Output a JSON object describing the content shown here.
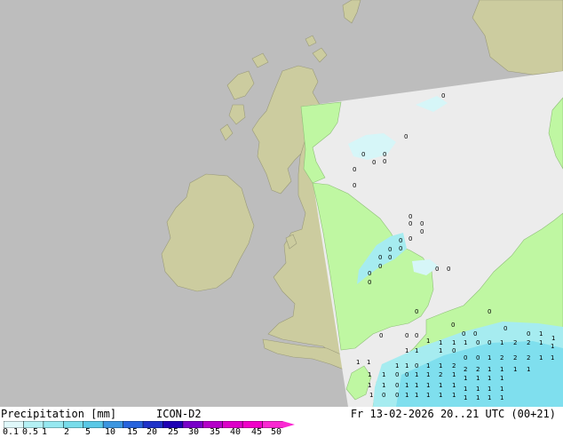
{
  "header": {
    "title": "Precipitation [mm]",
    "model": "ICON-D2",
    "datetime": "Fr 13-02-2026 20..21 UTC (00+21)"
  },
  "legend": {
    "ticks": [
      "0.1",
      "0.5",
      "1",
      "2",
      "5",
      "10",
      "15",
      "20",
      "25",
      "30",
      "35",
      "40",
      "45",
      "50"
    ],
    "colors": [
      "#e0f8fa",
      "#b4f0f4",
      "#96e8f0",
      "#78dcea",
      "#5ac8e6",
      "#3c96e0",
      "#2864dc",
      "#1e32c8",
      "#1e00b4",
      "#7800c8",
      "#b400c8",
      "#dc00c8",
      "#f000c8",
      "#fa28d2"
    ]
  },
  "map": {
    "colors": {
      "sea": "#bdbdbd",
      "land_outside": "#cccc9f",
      "domain_sea": "#ececec",
      "domain_land": "#bff7a2",
      "rain_light": "#a6ecf0",
      "rain_heavy": "#7fdfee"
    },
    "labels": [
      {
        "t": "0"
      },
      {
        "t": "0"
      },
      {
        "t": "0"
      },
      {
        "t": "0"
      },
      {
        "t": "0"
      },
      {
        "t": "0"
      },
      {
        "t": "0"
      },
      {
        "t": "0"
      },
      {
        "t": "0"
      },
      {
        "t": "0"
      },
      {
        "t": "0"
      },
      {
        "t": "0"
      },
      {
        "t": "0"
      },
      {
        "t": "0"
      },
      {
        "t": "0"
      },
      {
        "t": "0"
      },
      {
        "t": "0"
      },
      {
        "t": "0"
      },
      {
        "t": "0"
      },
      {
        "t": "0"
      },
      {
        "t": "0"
      },
      {
        "t": "0"
      },
      {
        "t": "0"
      },
      {
        "t": "0"
      },
      {
        "t": "0"
      },
      {
        "t": "0"
      },
      {
        "t": "0"
      },
      {
        "t": "0"
      },
      {
        "t": "0"
      },
      {
        "t": "0"
      },
      {
        "t": "0"
      },
      {
        "t": "0"
      },
      {
        "t": "0"
      },
      {
        "t": "1"
      },
      {
        "t": "1"
      },
      {
        "t": "1"
      },
      {
        "t": "1"
      },
      {
        "t": "1"
      },
      {
        "t": "1"
      },
      {
        "t": "0"
      },
      {
        "t": "0"
      },
      {
        "t": "1"
      },
      {
        "t": "2"
      },
      {
        "t": "2"
      },
      {
        "t": "1"
      },
      {
        "t": "1"
      },
      {
        "t": "1"
      },
      {
        "t": "1"
      },
      {
        "t": "1"
      },
      {
        "t": "0"
      },
      {
        "t": "0"
      },
      {
        "t": "0"
      },
      {
        "t": "1"
      },
      {
        "t": "2"
      },
      {
        "t": "2"
      },
      {
        "t": "2"
      },
      {
        "t": "1"
      },
      {
        "t": "1"
      },
      {
        "t": "1"
      },
      {
        "t": "1"
      },
      {
        "t": "1"
      },
      {
        "t": "1"
      },
      {
        "t": "0"
      },
      {
        "t": "1"
      },
      {
        "t": "1"
      },
      {
        "t": "2"
      },
      {
        "t": "2"
      },
      {
        "t": "2"
      },
      {
        "t": "1"
      },
      {
        "t": "1"
      },
      {
        "t": "1"
      },
      {
        "t": "1"
      },
      {
        "t": "1"
      },
      {
        "t": "1"
      },
      {
        "t": "0"
      },
      {
        "t": "0"
      },
      {
        "t": "1"
      },
      {
        "t": "1"
      },
      {
        "t": "2"
      },
      {
        "t": "1"
      },
      {
        "t": "1"
      },
      {
        "t": "1"
      },
      {
        "t": "1"
      },
      {
        "t": "1"
      },
      {
        "t": "1"
      },
      {
        "t": "1"
      },
      {
        "t": "0"
      },
      {
        "t": "1"
      },
      {
        "t": "1"
      },
      {
        "t": "1"
      },
      {
        "t": "1"
      },
      {
        "t": "1"
      },
      {
        "t": "1"
      },
      {
        "t": "1"
      },
      {
        "t": "1"
      },
      {
        "t": "1"
      },
      {
        "t": "1"
      },
      {
        "t": "0"
      },
      {
        "t": "0"
      },
      {
        "t": "1"
      },
      {
        "t": "1"
      },
      {
        "t": "1"
      },
      {
        "t": "1"
      },
      {
        "t": "1"
      },
      {
        "t": "1"
      },
      {
        "t": "1"
      },
      {
        "t": "1"
      },
      {
        "t": "1"
      },
      {
        "t": "1"
      },
      {
        "t": "1"
      }
    ]
  }
}
